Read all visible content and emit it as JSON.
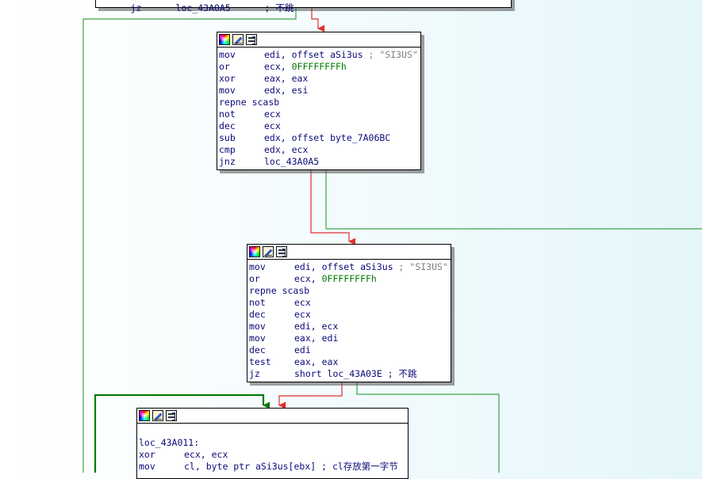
{
  "colors": {
    "text": "#0a0a7a",
    "number": "#007a00",
    "comment": "#808080",
    "edge_true": "#3ea34a",
    "edge_false": "#e03030",
    "edge_jump": "#0a7a0a"
  },
  "nodes": [
    {
      "id": "top",
      "lines": [
        {
          "mn": "jz",
          "op": "loc_43A0A5",
          "cn": "; 不跳"
        }
      ]
    },
    {
      "id": "block1",
      "lines": [
        {
          "mn": "mov",
          "op": "edi, offset aSi3us",
          "cmt": " ; \"SI3US\""
        },
        {
          "mn": "or",
          "op": "ecx, ",
          "num": "0FFFFFFFFh"
        },
        {
          "mn": "xor",
          "op": "eax, eax"
        },
        {
          "mn": "mov",
          "op": "edx, esi"
        },
        {
          "mn": "repne",
          "op": "scasb",
          "compact": true
        },
        {
          "mn": "not",
          "op": "ecx"
        },
        {
          "mn": "dec",
          "op": "ecx"
        },
        {
          "mn": "sub",
          "op": "edx, offset byte_7A06BC"
        },
        {
          "mn": "cmp",
          "op": "edx, ecx"
        },
        {
          "mn": "jnz",
          "op": "loc_43A0A5"
        }
      ]
    },
    {
      "id": "block2",
      "lines": [
        {
          "mn": "mov",
          "op": "edi, offset aSi3us",
          "cmt": " ; \"SI3US\""
        },
        {
          "mn": "or",
          "op": "ecx, ",
          "num": "0FFFFFFFFh"
        },
        {
          "mn": "repne",
          "op": "scasb",
          "compact": true
        },
        {
          "mn": "not",
          "op": "ecx"
        },
        {
          "mn": "dec",
          "op": "ecx"
        },
        {
          "mn": "mov",
          "op": "edi, ecx"
        },
        {
          "mn": "mov",
          "op": "eax, edi"
        },
        {
          "mn": "dec",
          "op": "edi"
        },
        {
          "mn": "test",
          "op": "eax, eax"
        },
        {
          "mn": "jz",
          "op": "short loc_43A03E",
          "cn": " ; 不跳"
        }
      ]
    },
    {
      "id": "block3",
      "lines": [
        {
          "mn": "",
          "op": ""
        },
        {
          "mn": "loc_43A011:",
          "op": "",
          "label": true
        },
        {
          "mn": "xor",
          "op": "ecx, ecx"
        },
        {
          "mn": "mov",
          "op": "cl, byte ptr aSi3us[ebx]",
          "cn": " ; cl存放第一字节"
        }
      ]
    }
  ]
}
